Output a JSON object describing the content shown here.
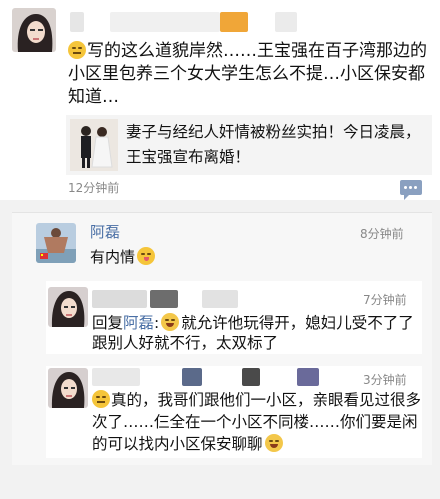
{
  "post": {
    "text": "写的这么道貌岸然……王宝强在百子湾那边的小区里包养三个女大学生怎么不提…小区保安都知道…",
    "share_title": "妻子与经纪人奸情被粉丝实拍！今日凌晨，王宝强宣布离婚！",
    "time": "12分钟前",
    "comment_icon": "comment-icon"
  },
  "comments": [
    {
      "name": "阿磊",
      "time": "8分钟前",
      "text": "有内情"
    }
  ],
  "replies": [
    {
      "time": "7分钟前",
      "prefix": "回复",
      "reply_to": "阿磊",
      "colon": ":",
      "text": "就允许他玩得开，媳妇儿受不了了跟别人好就不行，太双标了"
    },
    {
      "time": "3分钟前",
      "text": "真的，我哥们跟他们一小区，亲眼看见过很多次了……仨全在一个小区不同楼……你们要是闲的可以找内小区保安聊聊"
    }
  ],
  "colors": {
    "link_name": "#4a6fa5",
    "timestamp": "#888888",
    "background": "#f2f2f2"
  }
}
